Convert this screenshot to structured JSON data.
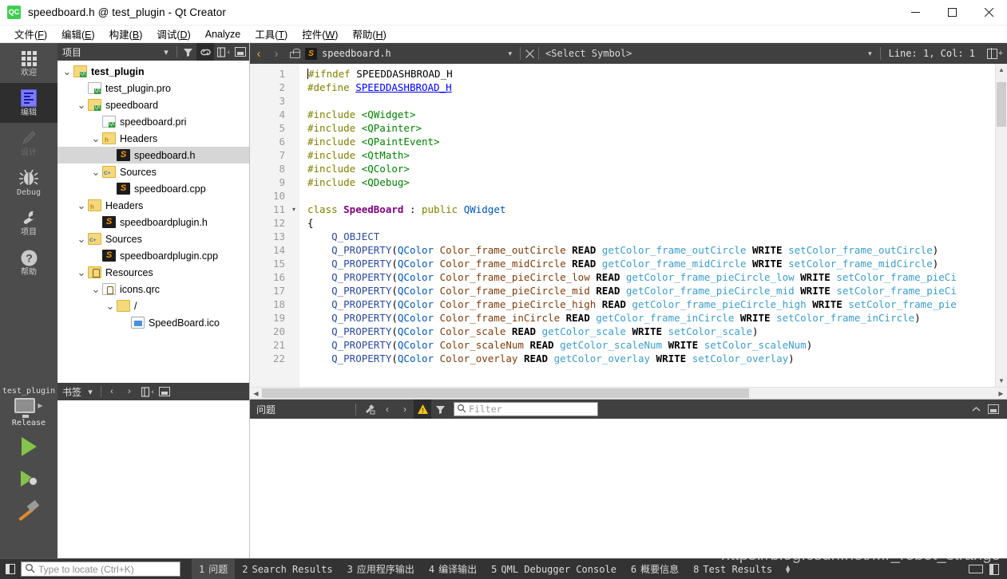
{
  "window": {
    "title": "speedboard.h @ test_plugin - Qt Creator",
    "logo_text": "QC",
    "minimize": "—",
    "maximize": "□",
    "close": "✕"
  },
  "menubar": {
    "items": [
      {
        "label": "文件(F)",
        "name": "menu-file"
      },
      {
        "label": "编辑(E)",
        "name": "menu-edit"
      },
      {
        "label": "构建(B)",
        "name": "menu-build"
      },
      {
        "label": "调试(D)",
        "name": "menu-debug"
      },
      {
        "label": "Analyze",
        "name": "menu-analyze"
      },
      {
        "label": "工具(T)",
        "name": "menu-tools"
      },
      {
        "label": "控件(W)",
        "name": "menu-window"
      },
      {
        "label": "帮助(H)",
        "name": "menu-help"
      }
    ]
  },
  "modebar": {
    "items": [
      {
        "label": "欢迎",
        "icon": "grid-icon",
        "state": "normal"
      },
      {
        "label": "编辑",
        "icon": "document-lines-icon",
        "state": "active"
      },
      {
        "label": "设计",
        "icon": "pencil-icon",
        "state": "disabled"
      },
      {
        "label": "Debug",
        "icon": "bug-icon",
        "state": "normal"
      },
      {
        "label": "项目",
        "icon": "wrench-icon",
        "state": "normal"
      },
      {
        "label": "帮助",
        "icon": "question-mark-icon",
        "state": "normal"
      }
    ],
    "kit": {
      "project": "test_plugin",
      "build_config": "Release",
      "run_label": "Run",
      "debug_label": "Start Debugging",
      "build_label": "Build"
    }
  },
  "project_panel": {
    "title": "项目",
    "toolbar": [
      "filter-icon",
      "link-icon",
      "split-icon",
      "minimize-icon"
    ],
    "tree": [
      {
        "label": "test_plugin",
        "indent": 0,
        "icon": "qt-project-folder-icon",
        "twisty": "down",
        "bold": true,
        "selected": false
      },
      {
        "label": "test_plugin.pro",
        "indent": 1,
        "icon": "qt-pro-file-icon",
        "twisty": "",
        "bold": false,
        "selected": false
      },
      {
        "label": "speedboard",
        "indent": 1,
        "icon": "qt-project-folder-icon",
        "twisty": "down",
        "bold": false,
        "selected": false
      },
      {
        "label": "speedboard.pri",
        "indent": 2,
        "icon": "qt-pro-file-icon",
        "twisty": "",
        "bold": false,
        "selected": false
      },
      {
        "label": "Headers",
        "indent": 2,
        "icon": "headers-folder-icon",
        "twisty": "down",
        "bold": false,
        "selected": false
      },
      {
        "label": "speedboard.h",
        "indent": 3,
        "icon": "sublime-file-icon",
        "twisty": "",
        "bold": false,
        "selected": true
      },
      {
        "label": "Sources",
        "indent": 2,
        "icon": "sources-folder-icon",
        "twisty": "down",
        "bold": false,
        "selected": false
      },
      {
        "label": "speedboard.cpp",
        "indent": 3,
        "icon": "sublime-file-icon",
        "twisty": "",
        "bold": false,
        "selected": false
      },
      {
        "label": "Headers",
        "indent": 1,
        "icon": "headers-folder-icon",
        "twisty": "down",
        "bold": false,
        "selected": false
      },
      {
        "label": "speedboardplugin.h",
        "indent": 2,
        "icon": "sublime-file-icon",
        "twisty": "",
        "bold": false,
        "selected": false
      },
      {
        "label": "Sources",
        "indent": 1,
        "icon": "sources-folder-icon",
        "twisty": "down",
        "bold": false,
        "selected": false
      },
      {
        "label": "speedboardplugin.cpp",
        "indent": 2,
        "icon": "sublime-file-icon",
        "twisty": "",
        "bold": false,
        "selected": false
      },
      {
        "label": "Resources",
        "indent": 1,
        "icon": "resources-folder-icon",
        "twisty": "down",
        "bold": false,
        "selected": false
      },
      {
        "label": "icons.qrc",
        "indent": 2,
        "icon": "qrc-file-icon",
        "twisty": "down",
        "bold": false,
        "selected": false
      },
      {
        "label": "/",
        "indent": 3,
        "icon": "plain-folder-icon",
        "twisty": "down",
        "bold": false,
        "selected": false
      },
      {
        "label": "SpeedBoard.ico",
        "indent": 4,
        "icon": "image-file-icon",
        "twisty": "",
        "bold": false,
        "selected": false
      }
    ]
  },
  "bookmarks_panel": {
    "title": "书签"
  },
  "editor_toolbar": {
    "back": "‹",
    "forward": "›",
    "lock_icon": "unlocked-icon",
    "filename": "speedboard.h",
    "dropdown_caret": "▾",
    "close": "✕",
    "symbol_selector": "<Select Symbol>",
    "line_col": "Line: 1, Col: 1",
    "split_label": "split-editor-icon"
  },
  "code": {
    "lines": [
      {
        "n": 1,
        "fold": "",
        "tokens": [
          {
            "t": "#ifndef ",
            "c": "pre"
          },
          {
            "t": "SPEEDDASHBROAD_H",
            "c": "plain"
          }
        ]
      },
      {
        "n": 2,
        "fold": "",
        "tokens": [
          {
            "t": "#define ",
            "c": "pre"
          },
          {
            "t": "SPEEDDASHBROAD_H",
            "c": "def"
          }
        ]
      },
      {
        "n": 3,
        "fold": "",
        "tokens": []
      },
      {
        "n": 4,
        "fold": "",
        "tokens": [
          {
            "t": "#include ",
            "c": "pre"
          },
          {
            "t": "<QWidget>",
            "c": "inc"
          }
        ]
      },
      {
        "n": 5,
        "fold": "",
        "tokens": [
          {
            "t": "#include ",
            "c": "pre"
          },
          {
            "t": "<QPainter>",
            "c": "inc"
          }
        ]
      },
      {
        "n": 6,
        "fold": "",
        "tokens": [
          {
            "t": "#include ",
            "c": "pre"
          },
          {
            "t": "<QPaintEvent>",
            "c": "inc"
          }
        ]
      },
      {
        "n": 7,
        "fold": "",
        "tokens": [
          {
            "t": "#include ",
            "c": "pre"
          },
          {
            "t": "<QtMath>",
            "c": "inc"
          }
        ]
      },
      {
        "n": 8,
        "fold": "",
        "tokens": [
          {
            "t": "#include ",
            "c": "pre"
          },
          {
            "t": "<QColor>",
            "c": "inc"
          }
        ]
      },
      {
        "n": 9,
        "fold": "",
        "tokens": [
          {
            "t": "#include ",
            "c": "pre"
          },
          {
            "t": "<QDebug>",
            "c": "inc"
          }
        ]
      },
      {
        "n": 10,
        "fold": "",
        "tokens": []
      },
      {
        "n": 11,
        "fold": "▾",
        "tokens": [
          {
            "t": "class ",
            "c": "kw"
          },
          {
            "t": "SpeedBoard",
            "c": "type"
          },
          {
            "t": " : ",
            "c": "plain"
          },
          {
            "t": "public ",
            "c": "kw"
          },
          {
            "t": "QWidget",
            "c": "qcolor"
          }
        ]
      },
      {
        "n": 12,
        "fold": "",
        "tokens": [
          {
            "t": "{",
            "c": "plain"
          }
        ]
      },
      {
        "n": 13,
        "fold": "",
        "tokens": [
          {
            "t": "    Q_OBJECT",
            "c": "prop"
          }
        ]
      },
      {
        "n": 14,
        "fold": "",
        "tokens": [
          {
            "t": "    Q_PROPERTY",
            "c": "prop"
          },
          {
            "t": "(",
            "c": "plain"
          },
          {
            "t": "QColor",
            "c": "qcolor"
          },
          {
            "t": " ",
            "c": "plain"
          },
          {
            "t": "Color_frame_outCircle",
            "c": "var"
          },
          {
            "t": " ",
            "c": "plain"
          },
          {
            "t": "READ",
            "c": "rw"
          },
          {
            "t": " ",
            "c": "plain"
          },
          {
            "t": "getColor_frame_outCircle",
            "c": "fn"
          },
          {
            "t": " ",
            "c": "plain"
          },
          {
            "t": "WRITE",
            "c": "rw"
          },
          {
            "t": " ",
            "c": "plain"
          },
          {
            "t": "setColor_frame_outCircle",
            "c": "fn"
          },
          {
            "t": ")",
            "c": "plain"
          }
        ]
      },
      {
        "n": 15,
        "fold": "",
        "tokens": [
          {
            "t": "    Q_PROPERTY",
            "c": "prop"
          },
          {
            "t": "(",
            "c": "plain"
          },
          {
            "t": "QColor",
            "c": "qcolor"
          },
          {
            "t": " ",
            "c": "plain"
          },
          {
            "t": "Color_frame_midCircle",
            "c": "var"
          },
          {
            "t": " ",
            "c": "plain"
          },
          {
            "t": "READ",
            "c": "rw"
          },
          {
            "t": " ",
            "c": "plain"
          },
          {
            "t": "getColor_frame_midCircle",
            "c": "fn"
          },
          {
            "t": " ",
            "c": "plain"
          },
          {
            "t": "WRITE",
            "c": "rw"
          },
          {
            "t": " ",
            "c": "plain"
          },
          {
            "t": "setColor_frame_midCircle",
            "c": "fn"
          },
          {
            "t": ")",
            "c": "plain"
          }
        ]
      },
      {
        "n": 16,
        "fold": "",
        "tokens": [
          {
            "t": "    Q_PROPERTY",
            "c": "prop"
          },
          {
            "t": "(",
            "c": "plain"
          },
          {
            "t": "QColor",
            "c": "qcolor"
          },
          {
            "t": " ",
            "c": "plain"
          },
          {
            "t": "Color_frame_pieCircle_low",
            "c": "var"
          },
          {
            "t": " ",
            "c": "plain"
          },
          {
            "t": "READ",
            "c": "rw"
          },
          {
            "t": " ",
            "c": "plain"
          },
          {
            "t": "getColor_frame_pieCircle_low",
            "c": "fn"
          },
          {
            "t": " ",
            "c": "plain"
          },
          {
            "t": "WRITE",
            "c": "rw"
          },
          {
            "t": " ",
            "c": "plain"
          },
          {
            "t": "setColor_frame_pieCi",
            "c": "fn"
          }
        ]
      },
      {
        "n": 17,
        "fold": "",
        "tokens": [
          {
            "t": "    Q_PROPERTY",
            "c": "prop"
          },
          {
            "t": "(",
            "c": "plain"
          },
          {
            "t": "QColor",
            "c": "qcolor"
          },
          {
            "t": " ",
            "c": "plain"
          },
          {
            "t": "Color_frame_pieCircle_mid",
            "c": "var"
          },
          {
            "t": " ",
            "c": "plain"
          },
          {
            "t": "READ",
            "c": "rw"
          },
          {
            "t": " ",
            "c": "plain"
          },
          {
            "t": "getColor_frame_pieCircle_mid",
            "c": "fn"
          },
          {
            "t": " ",
            "c": "plain"
          },
          {
            "t": "WRITE",
            "c": "rw"
          },
          {
            "t": " ",
            "c": "plain"
          },
          {
            "t": "setColor_frame_pieCi",
            "c": "fn"
          }
        ]
      },
      {
        "n": 18,
        "fold": "",
        "tokens": [
          {
            "t": "    Q_PROPERTY",
            "c": "prop"
          },
          {
            "t": "(",
            "c": "plain"
          },
          {
            "t": "QColor",
            "c": "qcolor"
          },
          {
            "t": " ",
            "c": "plain"
          },
          {
            "t": "Color_frame_pieCircle_high",
            "c": "var"
          },
          {
            "t": " ",
            "c": "plain"
          },
          {
            "t": "READ",
            "c": "rw"
          },
          {
            "t": " ",
            "c": "plain"
          },
          {
            "t": "getColor_frame_pieCircle_high",
            "c": "fn"
          },
          {
            "t": " ",
            "c": "plain"
          },
          {
            "t": "WRITE",
            "c": "rw"
          },
          {
            "t": " ",
            "c": "plain"
          },
          {
            "t": "setColor_frame_pie",
            "c": "fn"
          }
        ]
      },
      {
        "n": 19,
        "fold": "",
        "tokens": [
          {
            "t": "    Q_PROPERTY",
            "c": "prop"
          },
          {
            "t": "(",
            "c": "plain"
          },
          {
            "t": "QColor",
            "c": "qcolor"
          },
          {
            "t": " ",
            "c": "plain"
          },
          {
            "t": "Color_frame_inCircle",
            "c": "var"
          },
          {
            "t": " ",
            "c": "plain"
          },
          {
            "t": "READ",
            "c": "rw"
          },
          {
            "t": " ",
            "c": "plain"
          },
          {
            "t": "getColor_frame_inCircle",
            "c": "fn"
          },
          {
            "t": " ",
            "c": "plain"
          },
          {
            "t": "WRITE",
            "c": "rw"
          },
          {
            "t": " ",
            "c": "plain"
          },
          {
            "t": "setColor_frame_inCircle",
            "c": "fn"
          },
          {
            "t": ")",
            "c": "plain"
          }
        ]
      },
      {
        "n": 20,
        "fold": "",
        "tokens": [
          {
            "t": "    Q_PROPERTY",
            "c": "prop"
          },
          {
            "t": "(",
            "c": "plain"
          },
          {
            "t": "QColor",
            "c": "qcolor"
          },
          {
            "t": " ",
            "c": "plain"
          },
          {
            "t": "Color_scale",
            "c": "var"
          },
          {
            "t": " ",
            "c": "plain"
          },
          {
            "t": "READ",
            "c": "rw"
          },
          {
            "t": " ",
            "c": "plain"
          },
          {
            "t": "getColor_scale",
            "c": "fn"
          },
          {
            "t": " ",
            "c": "plain"
          },
          {
            "t": "WRITE",
            "c": "rw"
          },
          {
            "t": " ",
            "c": "plain"
          },
          {
            "t": "setColor_scale",
            "c": "fn"
          },
          {
            "t": ")",
            "c": "plain"
          }
        ]
      },
      {
        "n": 21,
        "fold": "",
        "tokens": [
          {
            "t": "    Q_PROPERTY",
            "c": "prop"
          },
          {
            "t": "(",
            "c": "plain"
          },
          {
            "t": "QColor",
            "c": "qcolor"
          },
          {
            "t": " ",
            "c": "plain"
          },
          {
            "t": "Color_scaleNum",
            "c": "var"
          },
          {
            "t": " ",
            "c": "plain"
          },
          {
            "t": "READ",
            "c": "rw"
          },
          {
            "t": " ",
            "c": "plain"
          },
          {
            "t": "getColor_scaleNum",
            "c": "fn"
          },
          {
            "t": " ",
            "c": "plain"
          },
          {
            "t": "WRITE",
            "c": "rw"
          },
          {
            "t": " ",
            "c": "plain"
          },
          {
            "t": "setColor_scaleNum",
            "c": "fn"
          },
          {
            "t": ")",
            "c": "plain"
          }
        ]
      },
      {
        "n": 22,
        "fold": "",
        "tokens": [
          {
            "t": "    Q_PROPERTY",
            "c": "prop"
          },
          {
            "t": "(",
            "c": "plain"
          },
          {
            "t": "QColor",
            "c": "qcolor"
          },
          {
            "t": " ",
            "c": "plain"
          },
          {
            "t": "Color_overlay",
            "c": "var"
          },
          {
            "t": " ",
            "c": "plain"
          },
          {
            "t": "READ",
            "c": "rw"
          },
          {
            "t": " ",
            "c": "plain"
          },
          {
            "t": "getColor_overlay",
            "c": "fn"
          },
          {
            "t": " ",
            "c": "plain"
          },
          {
            "t": "WRITE",
            "c": "rw"
          },
          {
            "t": " ",
            "c": "plain"
          },
          {
            "t": "setColor_overlay",
            "c": "fn"
          },
          {
            "t": ")",
            "c": "plain"
          }
        ]
      }
    ]
  },
  "issues_pane": {
    "title": "问题",
    "filter_placeholder": "Filter",
    "warning_active": true
  },
  "statusbar": {
    "locator_placeholder": "Type to locate (Ctrl+K)",
    "tabs": [
      {
        "num": "1",
        "label": "问题",
        "active": true
      },
      {
        "num": "2",
        "label": "Search Results",
        "active": false
      },
      {
        "num": "3",
        "label": "应用程序输出",
        "active": false
      },
      {
        "num": "4",
        "label": "编译输出",
        "active": false
      },
      {
        "num": "5",
        "label": "QML Debugger Console",
        "active": false
      },
      {
        "num": "6",
        "label": "概要信息",
        "active": false
      },
      {
        "num": "8",
        "label": "Test Results",
        "active": false
      }
    ]
  },
  "watermark": "https://blog.csdn.net/Mr_robot_strange",
  "colors": {
    "accent_green": "#41cd52",
    "dark_chrome": "#404040",
    "modebar": "#4c4c4c",
    "selection": "#d6d6d6",
    "warning": "#f0c419"
  }
}
